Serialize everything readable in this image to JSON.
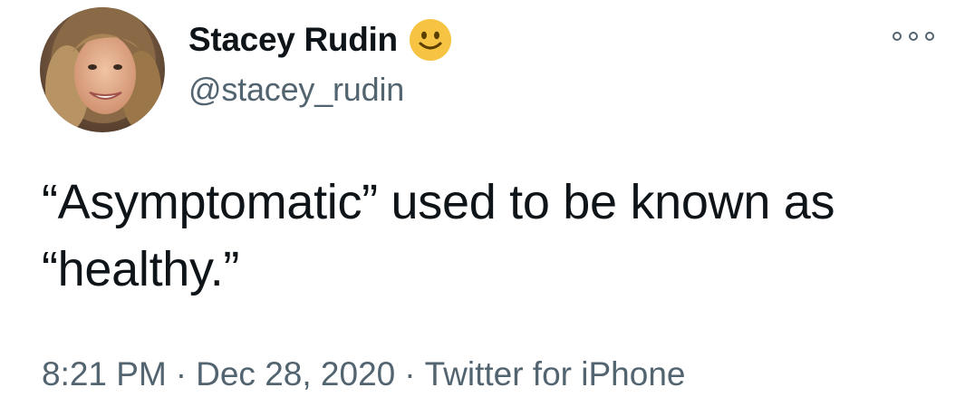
{
  "tweet": {
    "author": {
      "display_name": "Stacey Rudin",
      "handle": "@stacey_rudin",
      "emoji_icon": "slightly-smiling-face-emoji"
    },
    "text": "“Asymptomatic” used to be known as “healthy.”",
    "time": "8:21 PM",
    "separator": "·",
    "date": "Dec 28, 2020",
    "source": "Twitter for iPhone",
    "more_icon": "more-options-icon"
  },
  "colors": {
    "primary_text": "#0f1419",
    "secondary_text": "#536471",
    "emoji_face": "#f6c343",
    "background": "#ffffff"
  }
}
